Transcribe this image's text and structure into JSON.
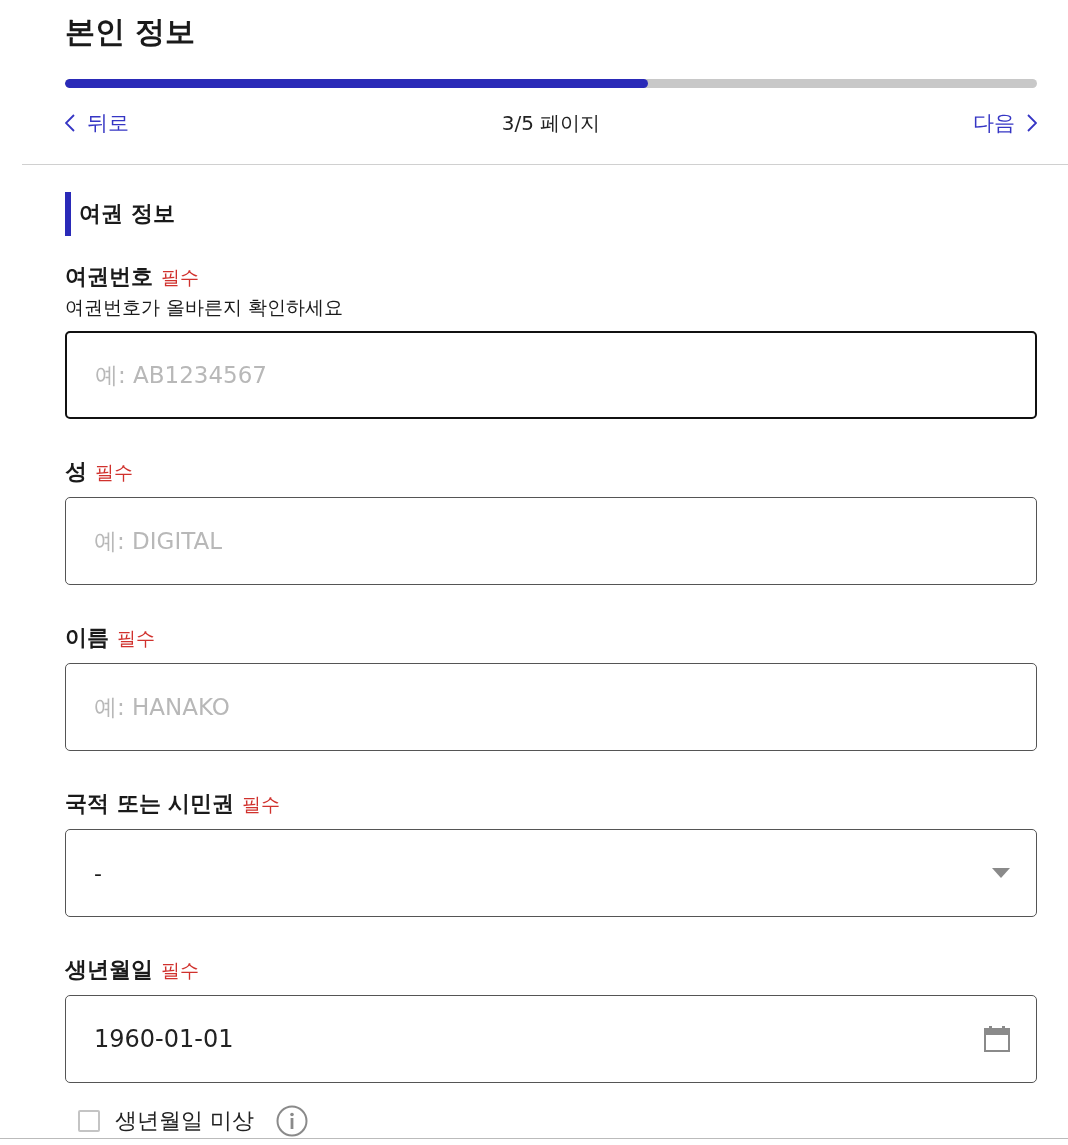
{
  "header": {
    "title": "본인 정보",
    "progress": {
      "level": 0.6
    },
    "back": {
      "label": "뒤로"
    },
    "page_indicator": "3/5 페이지",
    "next": {
      "label": "다음"
    }
  },
  "section": {
    "title": "여권 정보",
    "fields": [
      {
        "kind": "text",
        "label": "여권번호",
        "required_badge": "필수",
        "hint": "여권번호가 올바른지 확인하세요",
        "placeholder": "예: AB1234567",
        "focused": true
      },
      {
        "kind": "text",
        "label": "성",
        "required_badge": "필수",
        "placeholder": "예: DIGITAL",
        "focused": false
      },
      {
        "kind": "text",
        "label": "이름",
        "required_badge": "필수",
        "placeholder": "예: HANAKO",
        "focused": false
      },
      {
        "kind": "select",
        "label": "국적 또는 시민권",
        "required_badge": "필수",
        "value": "-",
        "focused": false
      },
      {
        "kind": "date",
        "label": "생년월일",
        "required_badge": "필수",
        "value": "1960-01-01",
        "focused": false
      }
    ],
    "checkbox": {
      "label": "생년월일 미상",
      "checked": false
    }
  }
}
